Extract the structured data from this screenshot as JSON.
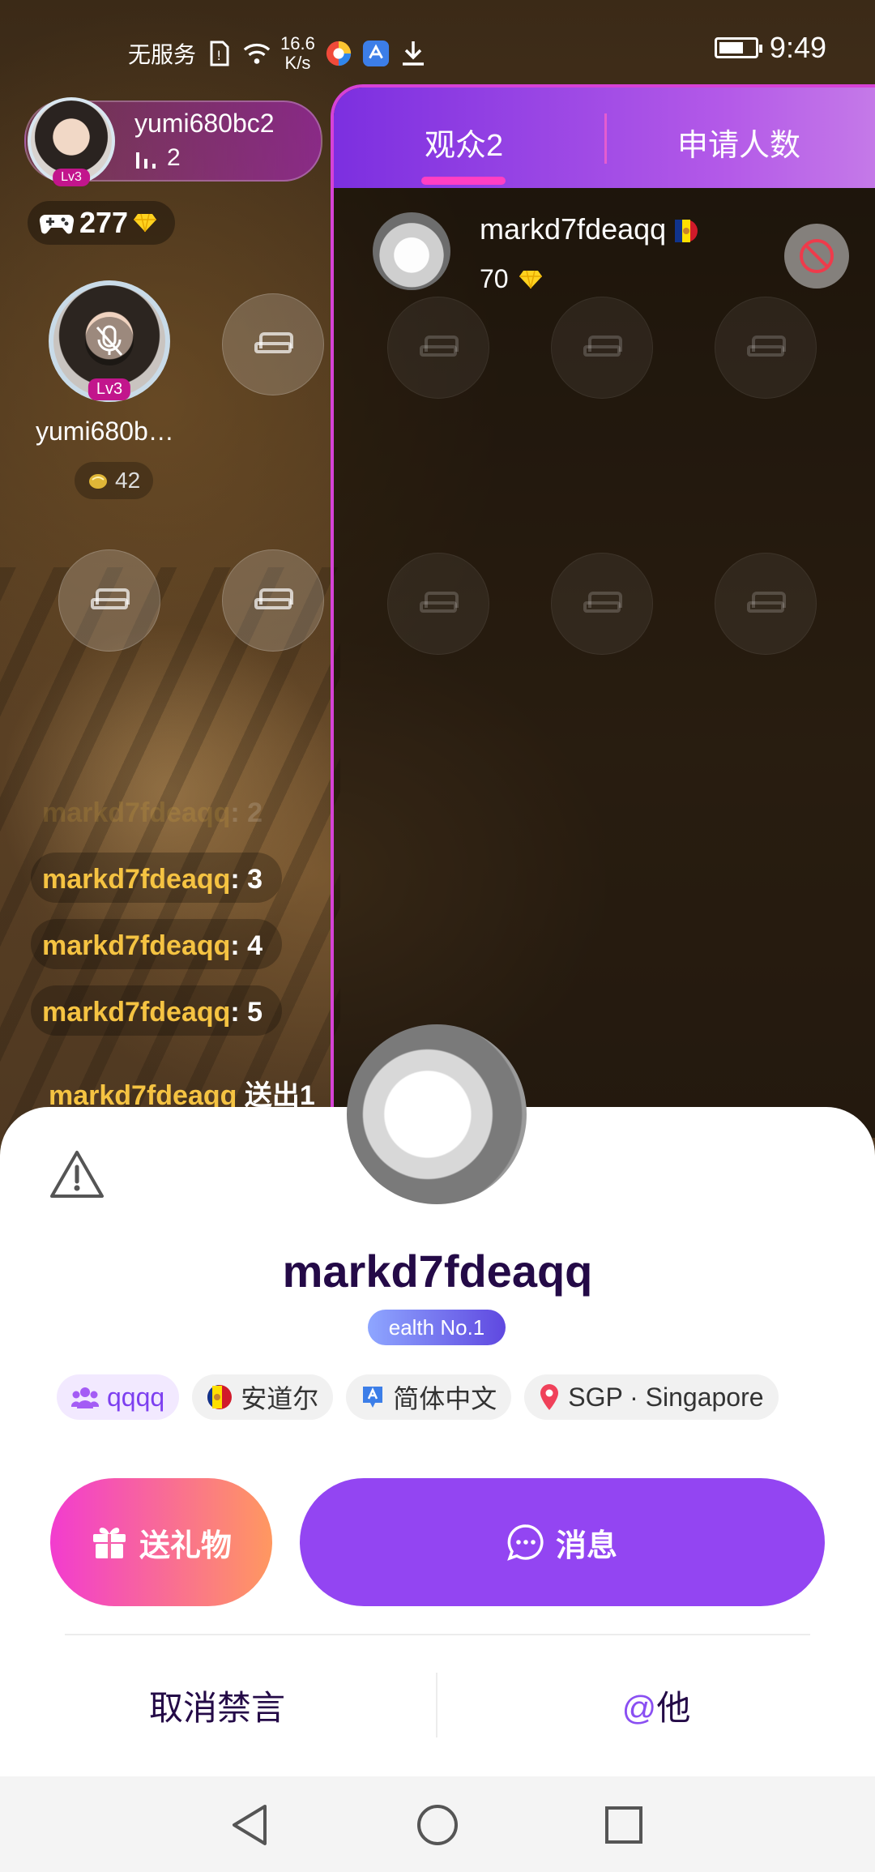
{
  "status": {
    "no_service": "无服务",
    "speed_value": "16.6",
    "speed_unit": "K/s",
    "time": "9:49"
  },
  "host": {
    "name": "yumi680bc2",
    "level": "Lv3",
    "listeners": "2",
    "coins": "277"
  },
  "mic": {
    "name": "yumi680b…",
    "level": "Lv3",
    "score": "42"
  },
  "chat": [
    {
      "user": "markd7fdeaqq",
      "text": ": 3"
    },
    {
      "user": "markd7fdeaqq",
      "text": ": 4"
    },
    {
      "user": "markd7fdeaqq",
      "text": ": 5"
    },
    {
      "user": "markd7fdeaqq",
      "text": "送出1"
    }
  ],
  "chat_faded": {
    "user": "markd7fdeaqq",
    "text": ": 2"
  },
  "panel": {
    "tabs": [
      {
        "label": "观众2"
      },
      {
        "label": "申请人数"
      }
    ],
    "audience": {
      "name": "markd7fdeaqq",
      "score": "70"
    }
  },
  "profile": {
    "name": "markd7fdeaqq",
    "badge": "ealth No.1",
    "tags": [
      {
        "label": "qqqq",
        "icon": "family-icon"
      },
      {
        "label": "安道尔",
        "icon": "andorra-flag-icon"
      },
      {
        "label": "简体中文",
        "icon": "language-icon"
      },
      {
        "label": "SGP · Singapore",
        "icon": "location-pin-icon"
      }
    ],
    "gift_button": "送礼物",
    "message_button": "消息",
    "unmute_label": "取消禁言",
    "mention_at": "@",
    "mention_label": "他"
  },
  "colors": {
    "accent_purple": "#9345f2",
    "gift_gradient_start": "#f23ccf",
    "gift_gradient_end": "#ff9860",
    "chat_name": "#f5c342",
    "panel_border": "#d642d6"
  }
}
